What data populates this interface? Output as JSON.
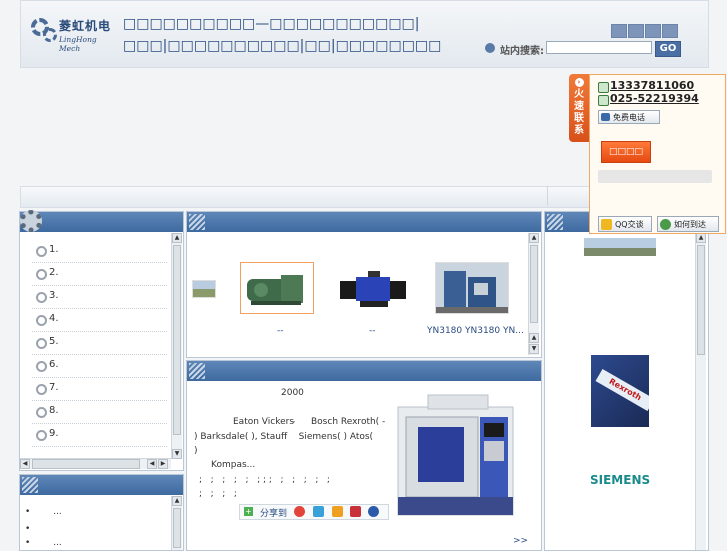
{
  "header": {
    "logo_cn": "菱虹机电",
    "logo_en": "LingHong Mech",
    "site_title": "□□□□□□□□□□—□□□□□□□□□□□|□□□|□□□□□□□□□□|□□|□□□□□□□□",
    "search_label": "站内搜索:",
    "search_placeholder": "",
    "search_button": "GO"
  },
  "contact": {
    "tab_label": "火速联系",
    "phone1": "13337811060",
    "phone2": "025-52219394",
    "free_call": "免费电话",
    "online_button": "□□□□",
    "qq_button": "QQ交谈",
    "how_to_get": "如何到达"
  },
  "left_list": {
    "items": [
      "1.",
      "2.",
      "3.",
      "4.",
      "5.",
      "6.",
      "7.",
      "8.",
      "9."
    ]
  },
  "products": {
    "captions": [
      "--",
      "--",
      "YN3180 YN3180 YN..."
    ]
  },
  "intro": {
    "year": "2000",
    "line1_a": "Eaton Vickers",
    "line1_sep": "-",
    "line1_b": "Bosch Rexroth( -",
    "line2": ") Barksdale( ), Stauff    Siemens( ) Atos(",
    "line3": ")",
    "line4": "Kompas...",
    "line5": ";   ;   ;   ;   ;   ; ; ;   ;   ;   ;   ;   ;",
    "line6": ";   ;   ;   ;",
    "share_label": "分享到",
    "more": ">>"
  },
  "bottom_left": {
    "items": [
      "...",
      "",
      "..."
    ]
  },
  "brands": {
    "rexroth": "Rexroth",
    "siemens": "SIEMENS"
  },
  "colors": {
    "panel_header": "#3e6aa0",
    "accent_orange": "#e64a10",
    "link_blue": "#2a4c80"
  }
}
